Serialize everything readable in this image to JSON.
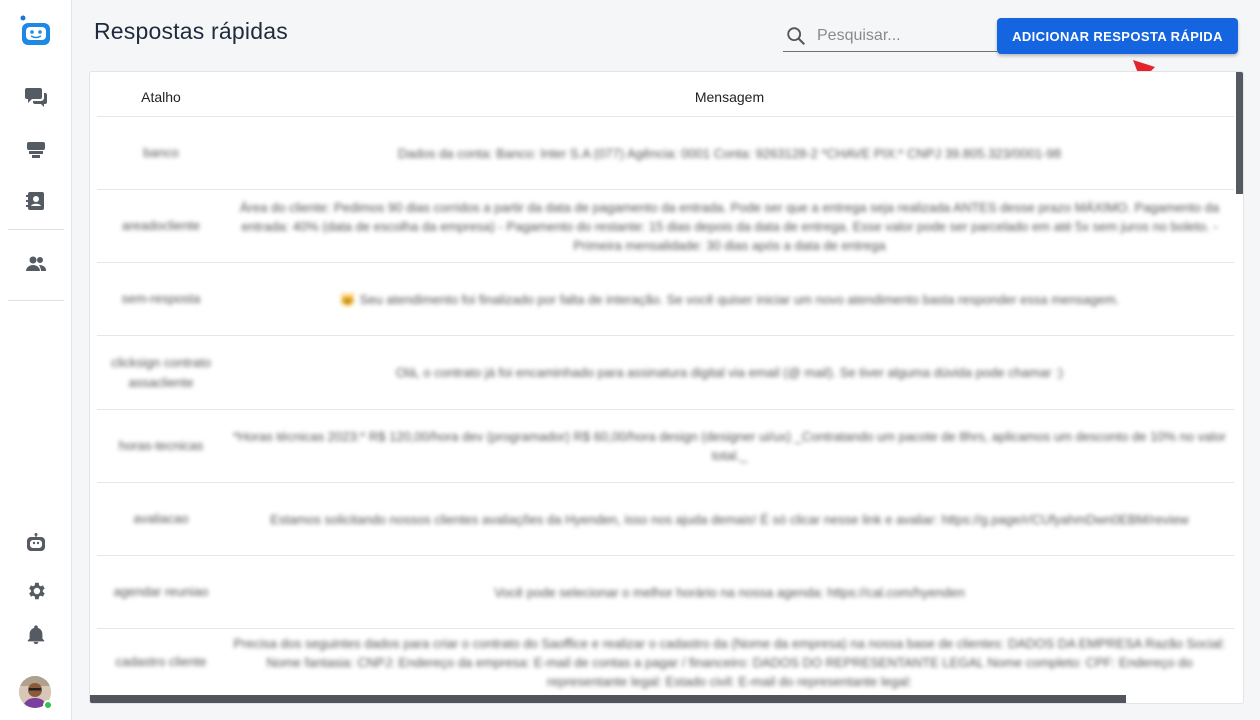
{
  "header": {
    "title": "Respostas rápidas",
    "search_placeholder": "Pesquisar...",
    "add_button_label": "ADICIONAR RESPOSTA RÁPIDA"
  },
  "table": {
    "columns": [
      "Atalho",
      "Mensagem"
    ],
    "rows": [
      {
        "shortcut": "banco",
        "message": "Dados da conta: Banco: Inter S.A (077) Agência: 0001 Conta: 9263128-2 *CHAVE PIX:* CNPJ 39.805.323/0001-98"
      },
      {
        "shortcut": "areadocliente",
        "message": "Área do cliente: Pedimos 90 dias corridos a partir da data de pagamento da entrada. Pode ser que a entrega seja realizada ANTES desse prazo MÁXIMO. Pagamento da entrada: 40% (data de escolha da empresa) - Pagamento do restante: 15 dias depois da data de entrega. Esse valor pode ser parcelado em até 5x sem juros no boleto. - Primeira mensalidade: 30 dias após a data de entrega"
      },
      {
        "shortcut": "sem-resposta",
        "message": "🐱 Seu atendimento foi finalizado por falta de interação. Se você quiser iniciar um novo atendimento basta responder essa mensagem."
      },
      {
        "shortcut": "clicksign contrato assaclientе",
        "message": "Olá, o contrato já foi encaminhado para assinatura digital via email (@ mail). Se tiver alguma dúvida pode chamar :)"
      },
      {
        "shortcut": "horas-tecnicas",
        "message": "*Horas técnicas 2023:* R$ 120,00/hora dev (programador) R$ 60,00/hora design (designer ui/ux) _Contratando um pacote de 8hrs, aplicamos um desconto de 10% no valor total._"
      },
      {
        "shortcut": "avaliacao",
        "message": "Estamos solicitando nossos clientes avaliações da Hyenden, isso nos ajuda demais! É só clicar nesse link e avaliar: https://g.page/r/CUfyahmDwn0EBM/review"
      },
      {
        "shortcut": "agendar reuniao",
        "message": "Você pode selecionar o melhor horário na nossa agenda: https://cal.com/hyenden"
      },
      {
        "shortcut": "cadastro cliente",
        "message": "Precisa dos seguintes dados para criar o contrato do Saoffice e realizar o cadastro da (Nome da empresa) na nossa base de clientes: DADOS DA EMPRESA Razão Social: Nome fantasia: CNPJ: Endereço da empresa: E-mail de contas a pagar / financeiro: DADOS DO REPRESENTANTE LEGAL Nome completo: CPF: Endereço do representante legal: Estado civil: E-mail do representante legal:"
      }
    ]
  },
  "sidebar": {
    "icons": [
      "bot-logo-icon",
      "chat-icon",
      "inbox-icon",
      "contacts-icon",
      "team-icon",
      "bot-icon",
      "settings-icon",
      "notifications-icon"
    ]
  },
  "colors": {
    "primary": "#1565e0",
    "arrow": "#e3242b",
    "status_online": "#2ec34a"
  }
}
